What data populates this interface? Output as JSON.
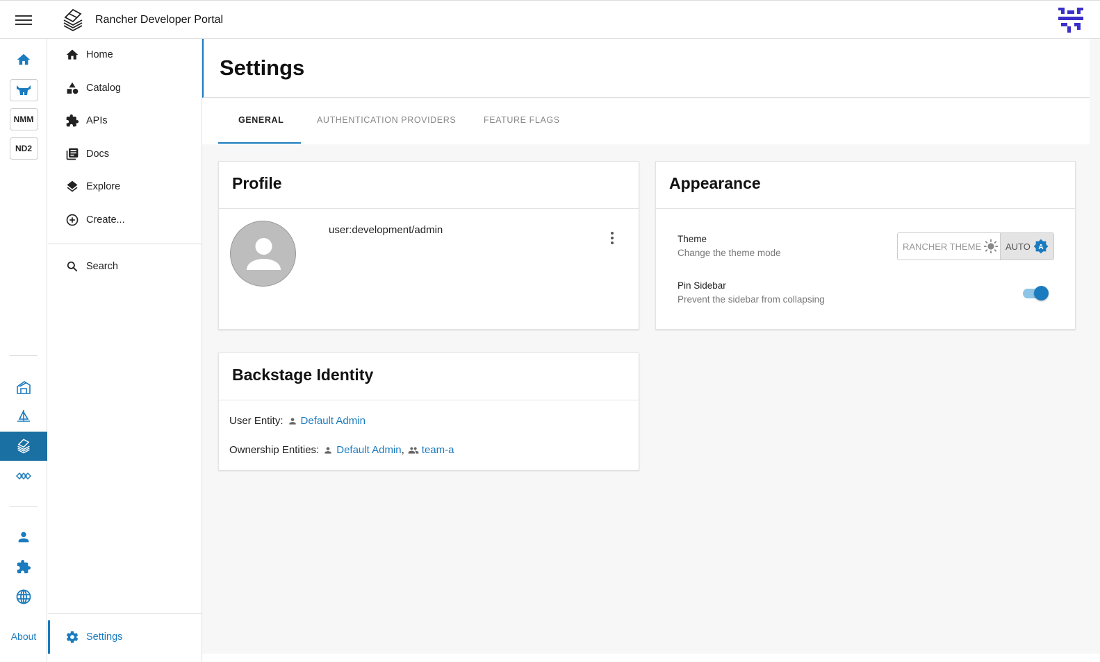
{
  "header": {
    "app_title": "Rancher Developer Portal"
  },
  "rail": {
    "badges": [
      "NMM",
      "ND2"
    ],
    "about_label": "About"
  },
  "nav": {
    "items": [
      {
        "label": "Home",
        "icon": "home-icon"
      },
      {
        "label": "Catalog",
        "icon": "category-icon"
      },
      {
        "label": "APIs",
        "icon": "extension-icon"
      },
      {
        "label": "Docs",
        "icon": "library-books-icon"
      },
      {
        "label": "Explore",
        "icon": "layers-icon"
      },
      {
        "label": "Create...",
        "icon": "add-circle-icon"
      }
    ],
    "search_label": "Search",
    "settings_label": "Settings"
  },
  "page": {
    "title": "Settings",
    "tabs": [
      "GENERAL",
      "AUTHENTICATION PROVIDERS",
      "FEATURE FLAGS"
    ],
    "active_tab": "GENERAL"
  },
  "profile": {
    "title": "Profile",
    "user_ref": "user:development/admin"
  },
  "appearance": {
    "title": "Appearance",
    "theme_label": "Theme",
    "theme_desc": "Change the theme mode",
    "theme_options": [
      "RANCHER THEME",
      "AUTO"
    ],
    "theme_selected": "AUTO",
    "pin_label": "Pin Sidebar",
    "pin_desc": "Prevent the sidebar from collapsing",
    "pin_enabled": true
  },
  "identity": {
    "title": "Backstage Identity",
    "user_entity_label": "User Entity:",
    "user_entity": "Default Admin",
    "ownership_label": "Ownership Entities:",
    "ownership_user": "Default Admin",
    "ownership_sep": ",",
    "ownership_group": "team-a"
  },
  "colors": {
    "accent": "#1a7bbf",
    "rail_active": "#1a6fa3"
  }
}
